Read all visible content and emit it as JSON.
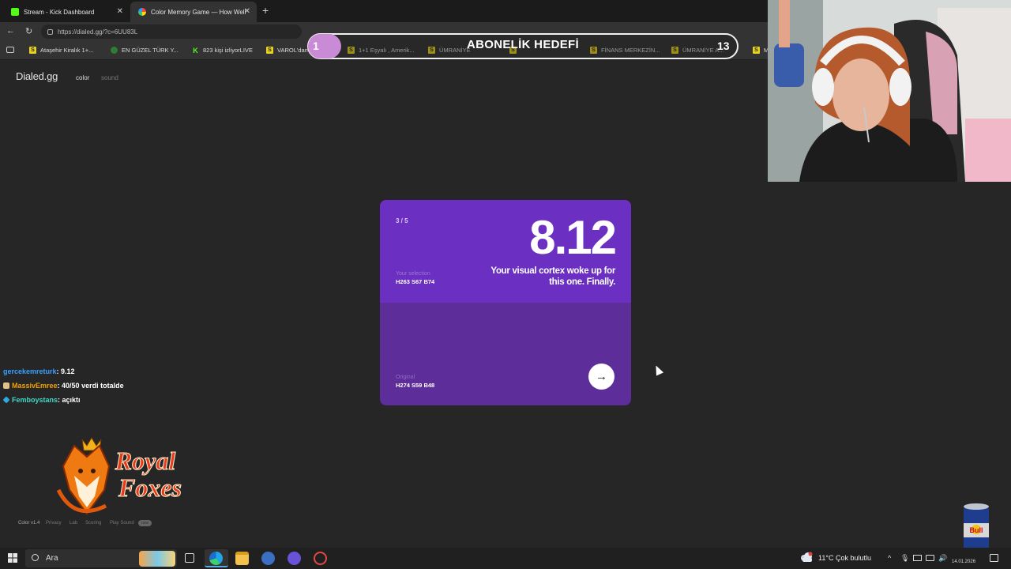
{
  "browser": {
    "tabs": [
      {
        "title": "Stream - Kick Dashboard",
        "active": false
      },
      {
        "title": "Color Memory Game — How Well",
        "active": true
      }
    ],
    "url": "https://dialed.gg/?c=6UU83L",
    "bookmarks": [
      {
        "label": "Ataşehir Kiralık 1+...",
        "icon": "S"
      },
      {
        "label": "EN GÜZEL TÜRK Y...",
        "icon": "globe"
      },
      {
        "label": "823 kişi izliyorLIVE",
        "icon": "K"
      },
      {
        "label": "VAROL'dan",
        "icon": "S"
      },
      {
        "label": "1+1 Eşyalı , Amerik...",
        "icon": "S"
      },
      {
        "label": "ÜMRANİYE",
        "icon": "S"
      },
      {
        "label": "",
        "icon": "S"
      },
      {
        "label": "FİNANS MERKEZİN...",
        "icon": "S"
      },
      {
        "label": "ÜMRANİYE A...",
        "icon": "S"
      },
      {
        "label": "M",
        "icon": "S"
      }
    ]
  },
  "goal": {
    "current": "1",
    "title": "ABONELİK HEDEFİ",
    "target": "13",
    "fill_colour": "#c98ad6"
  },
  "site": {
    "brand": "Dialed.gg",
    "nav": {
      "color": "color",
      "sound": "sound"
    },
    "footer": {
      "version": "Color v1.4",
      "privacy": "Privacy",
      "lab": "Lab",
      "scoring": "Scoring",
      "playsound": "Play Sound",
      "badge": "new"
    }
  },
  "result": {
    "progress": "3 / 5",
    "score": "8.12",
    "verdict": "Your visual cortex woke up for this one. Finally.",
    "selection_label": "Your selection",
    "selection_value": "H263 S67 B74",
    "original_label": "Original",
    "original_value": "H274 S59 B48",
    "selection_colour": "#6b2fc1",
    "original_colour": "#5d2e9a"
  },
  "chat": [
    {
      "user": "gercekemreturk",
      "message": ": 9.12"
    },
    {
      "user": "MassivEmree",
      "message": ": 40/50 verdi totalde"
    },
    {
      "user": "Femboystans",
      "message": ": açıktı"
    }
  ],
  "logo_text": "Royal Foxes",
  "taskbar": {
    "search_placeholder": "Ara",
    "weather": "11°C  Çok bulutlu",
    "date": "14.01.2026"
  }
}
